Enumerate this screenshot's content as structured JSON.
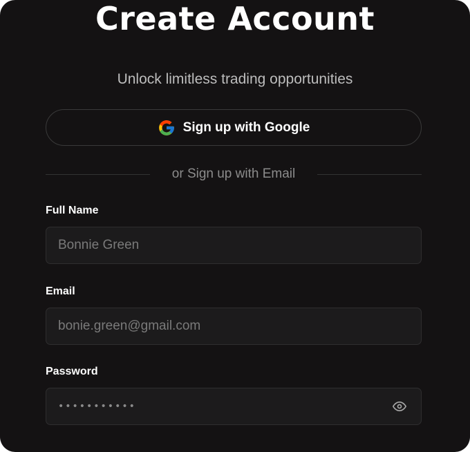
{
  "header": {
    "title": "Create Account",
    "subtitle": "Unlock limitless trading opportunities"
  },
  "google": {
    "label": "Sign up with Google",
    "icon": "google-logo-icon"
  },
  "divider": {
    "text": "or Sign up with Email"
  },
  "form": {
    "full_name": {
      "label": "Full Name",
      "placeholder": "Bonnie Green"
    },
    "email": {
      "label": "Email",
      "placeholder": "bonie.green@gmail.com"
    },
    "password": {
      "label": "Password",
      "value_masked": "•••••••••••",
      "toggle_icon": "eye-icon"
    }
  },
  "colors": {
    "background": "#141213",
    "input_bg": "#1c1b1c",
    "border": "#3a3a3a",
    "text_primary": "#ffffff",
    "text_muted": "#8c8c8c"
  }
}
